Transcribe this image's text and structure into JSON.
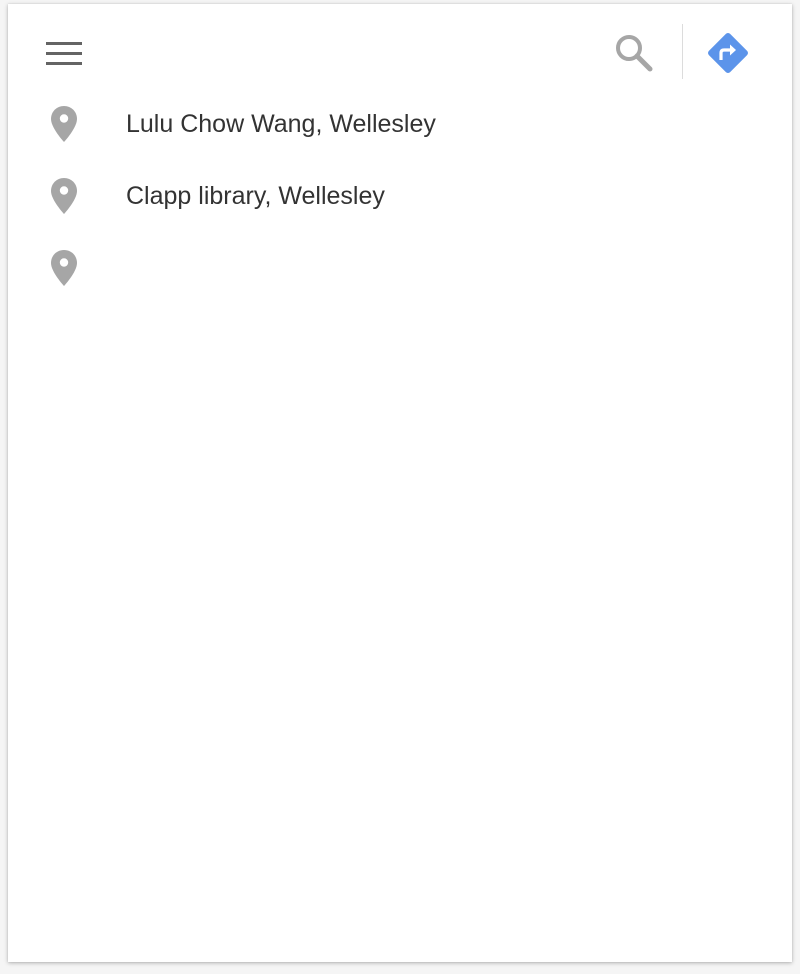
{
  "toolbar": {
    "menu_icon": "hamburger-menu-icon",
    "search_icon": "search-icon",
    "directions_icon": "directions-icon",
    "accent_color": "#5c94ea",
    "icon_gray": "#a6a6a6"
  },
  "suggestions": [
    {
      "icon": "map-pin-icon",
      "label": "Lulu Chow Wang, Wellesley"
    },
    {
      "icon": "map-pin-icon",
      "label": "Clapp library, Wellesley"
    },
    {
      "icon": "map-pin-icon",
      "label": ""
    }
  ]
}
